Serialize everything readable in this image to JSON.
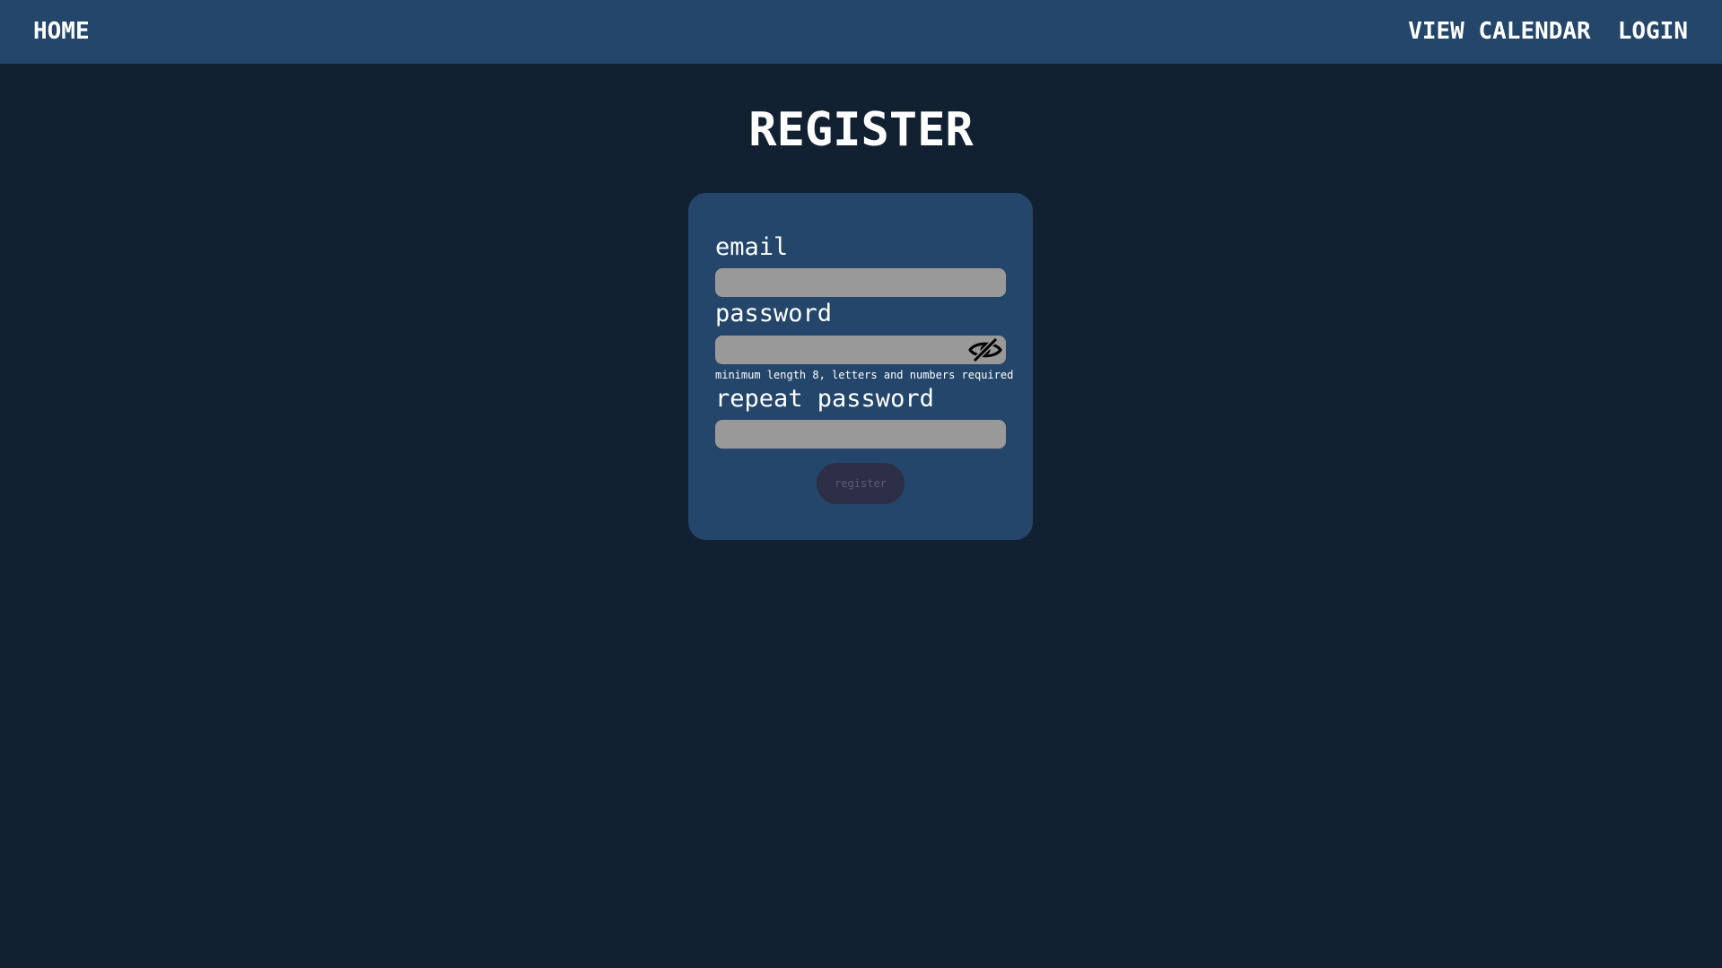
{
  "nav": {
    "home": "HOME",
    "view_calendar": "VIEW CALENDAR",
    "login": "LOGIN"
  },
  "page": {
    "title": "REGISTER"
  },
  "form": {
    "email_label": "email",
    "email_value": "",
    "password_label": "password",
    "password_value": "",
    "password_toggle_icon": "eye-slash-icon",
    "password_hint": "minimum length 8, letters and numbers required",
    "repeat_password_label": "repeat password",
    "repeat_password_value": "",
    "submit_label": "register"
  },
  "colors": {
    "page_background": "#122132",
    "navbar_background": "#24466a",
    "card_background": "#24466a",
    "input_background": "#999999",
    "button_background": "#2c2f45",
    "button_text": "#5b5f78"
  }
}
